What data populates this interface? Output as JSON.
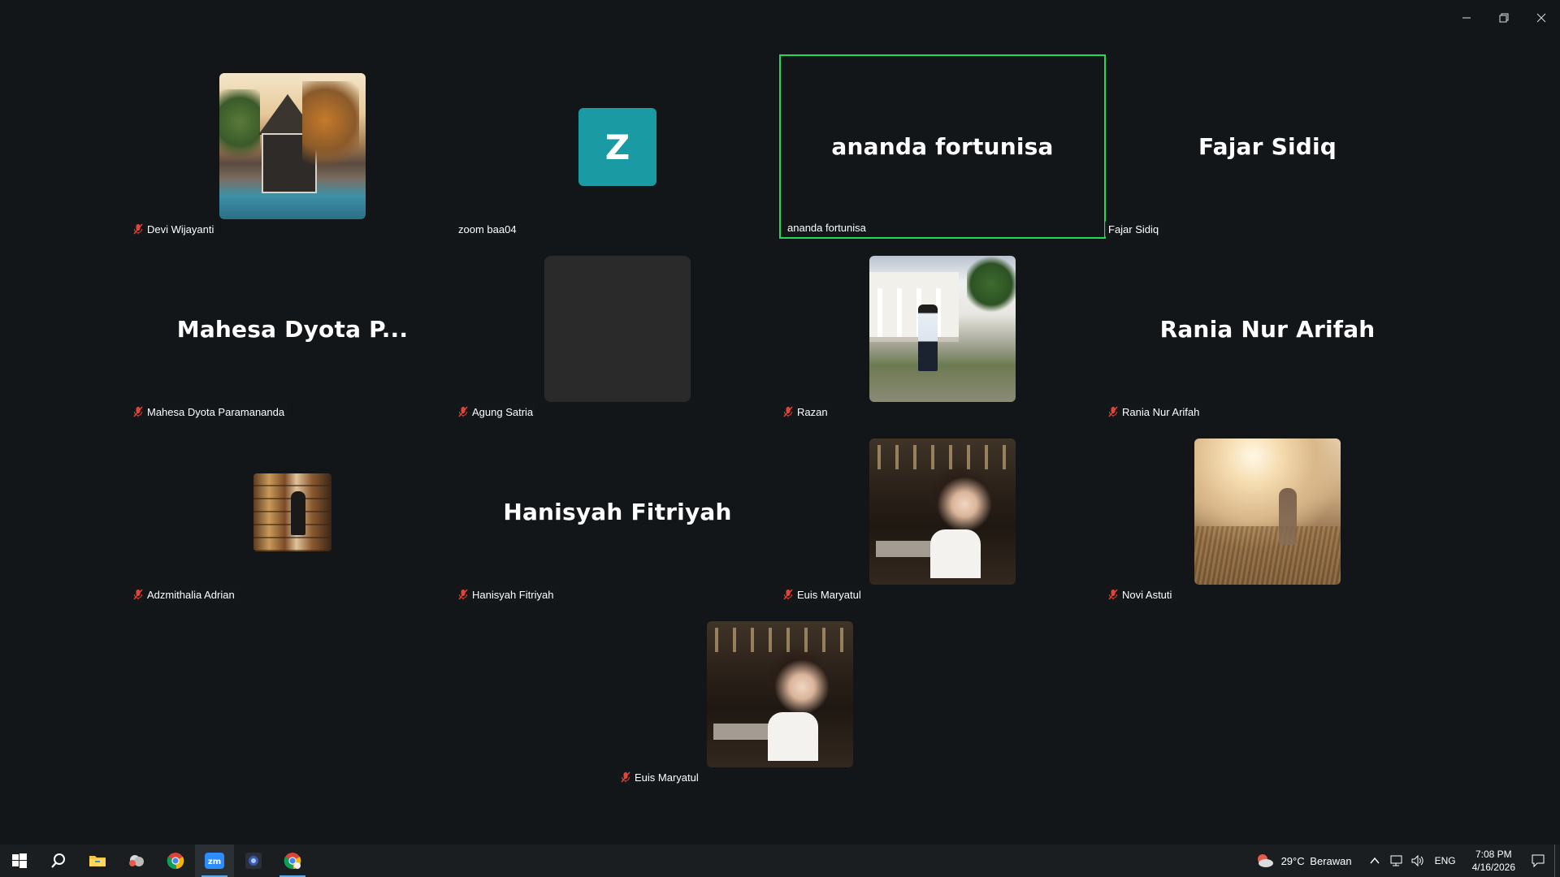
{
  "window": {
    "controls": [
      "minimize",
      "restore",
      "close"
    ]
  },
  "participants": [
    {
      "name": "Devi Wijayanti",
      "display": "",
      "muted": true,
      "avatar": "photo-house"
    },
    {
      "name": "zoom baa04",
      "display": "",
      "muted": false,
      "avatar_letter": "Z"
    },
    {
      "name": "ananda fortunisa",
      "display": "ananda fortunisa",
      "muted": false,
      "active_speaker": true
    },
    {
      "name": "Fajar Sidiq",
      "display": "Fajar Sidiq",
      "muted": false
    },
    {
      "name": "Mahesa Dyota Paramananda",
      "display": "Mahesa Dyota P...",
      "muted": true
    },
    {
      "name": "Agung Satria",
      "display": "",
      "muted": true,
      "avatar": "empty"
    },
    {
      "name": "Razan",
      "display": "",
      "muted": true,
      "avatar": "photo-outdoor"
    },
    {
      "name": "Rania Nur Arifah",
      "display": "Rania Nur Arifah",
      "muted": true
    },
    {
      "name": "Adzmithalia Adrian",
      "display": "",
      "muted": true,
      "avatar": "photo-library"
    },
    {
      "name": "Hanisyah Fitriyah",
      "display": "Hanisyah Fitriyah",
      "muted": true
    },
    {
      "name": "Euis Maryatul",
      "display": "",
      "muted": true,
      "avatar": "photo-cafe"
    },
    {
      "name": "Novi Astuti",
      "display": "",
      "muted": true,
      "avatar": "photo-sunset"
    },
    {
      "name": "Euis Maryatul",
      "display": "",
      "muted": true,
      "avatar": "photo-cafe"
    }
  ],
  "taskbar": {
    "apps": [
      "start-icon",
      "search-icon",
      "file-explorer-icon",
      "weather-app-icon",
      "chrome-icon",
      "zoom-icon",
      "camera-app-icon",
      "chrome-profile-icon"
    ],
    "active_app": "zoom-icon",
    "weather": {
      "temp": "29°C",
      "condition": "Berawan"
    },
    "language": "ENG",
    "time": "7:08 PM",
    "date": "4/16/2026"
  },
  "colors": {
    "background": "#121619",
    "active_speaker_border": "#23d959",
    "letter_avatar": "#1a9ba3",
    "muted_icon": "#e0453a"
  }
}
